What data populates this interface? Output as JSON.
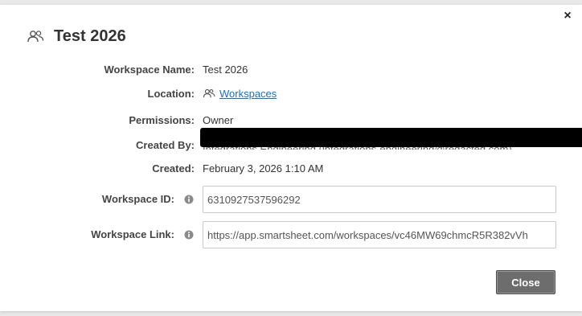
{
  "dialog": {
    "title": "Test 2026",
    "close_glyph": "×",
    "header_icon": "people-icon"
  },
  "fields": {
    "workspace_name": {
      "label": "Workspace Name:",
      "value": "Test 2026"
    },
    "location": {
      "label": "Location:",
      "value": "Workspaces",
      "icon": "people-icon"
    },
    "permissions": {
      "label": "Permissions:",
      "value": "Owner"
    },
    "created_by": {
      "label": "Created By:",
      "value": "Integrations Engineering (integrations-engineering@redacted.com)",
      "redacted": true
    },
    "created": {
      "label": "Created:",
      "value": "February 3, 2026 1:10 AM"
    },
    "workspace_id": {
      "label": "Workspace ID:",
      "value": "6310927537596292",
      "info_icon": "info-icon"
    },
    "workspace_link": {
      "label": "Workspace Link:",
      "value": "https://app.smartsheet.com/workspaces/vc46MW69chmcR5R382vVh",
      "info_icon": "info-icon"
    }
  },
  "buttons": {
    "close_label": "Close"
  },
  "colors": {
    "link": "#1a6fc4",
    "button_bg": "#6d6d6d",
    "redaction": "#000000"
  }
}
